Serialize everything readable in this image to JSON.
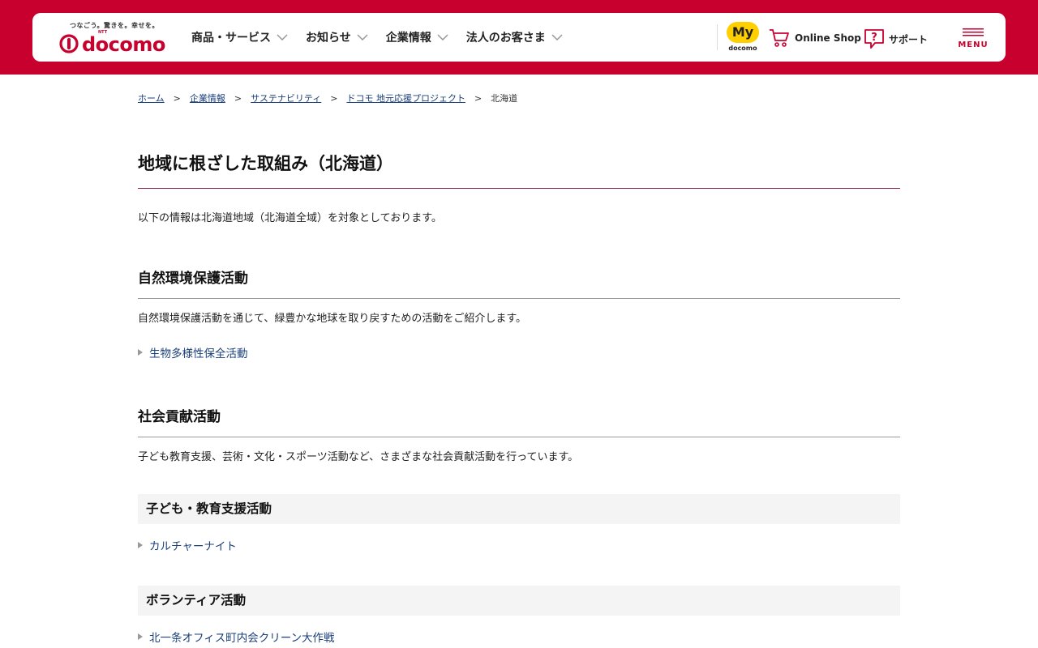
{
  "header": {
    "tagline": "つなごう。驚きを。幸せを。",
    "brand": "docomo",
    "brand_sub": "NTT",
    "nav": [
      {
        "label": "商品・サービス"
      },
      {
        "label": "お知らせ"
      },
      {
        "label": "企業情報"
      },
      {
        "label": "法人のお客さま"
      }
    ],
    "my_docomo": {
      "badge": "My",
      "sub": "docomo"
    },
    "online_shop": "Online Shop",
    "support": "サポート",
    "menu": "MENU",
    "colors": {
      "brand_red": "#c8002e",
      "my_yellow": "#ffcf00"
    }
  },
  "breadcrumb": {
    "items": [
      "ホーム",
      "企業情報",
      "サステナビリティ",
      "ドコモ 地元応援プロジェクト"
    ],
    "separator": ">",
    "current": "北海道"
  },
  "page": {
    "title": "地域に根ざした取組み（北海道）",
    "intro": "以下の情報は北海道地域（北海道全域）を対象としております。"
  },
  "sections": [
    {
      "heading": "自然環境保護活動",
      "description": "自然環境保護活動を通じて、緑豊かな地球を取り戻すための活動をご紹介します。",
      "links": [
        "生物多様性保全活動"
      ]
    },
    {
      "heading": "社会貢献活動",
      "description": "子ども教育支援、芸術・文化・スポーツ活動など、さまざまな社会貢献活動を行っています。",
      "subsections": [
        {
          "label": "子ども・教育支援活動",
          "links": [
            "カルチャーナイト"
          ]
        },
        {
          "label": "ボランティア活動",
          "links": [
            "北一条オフィス町内会クリーン大作戦"
          ]
        }
      ]
    }
  ]
}
